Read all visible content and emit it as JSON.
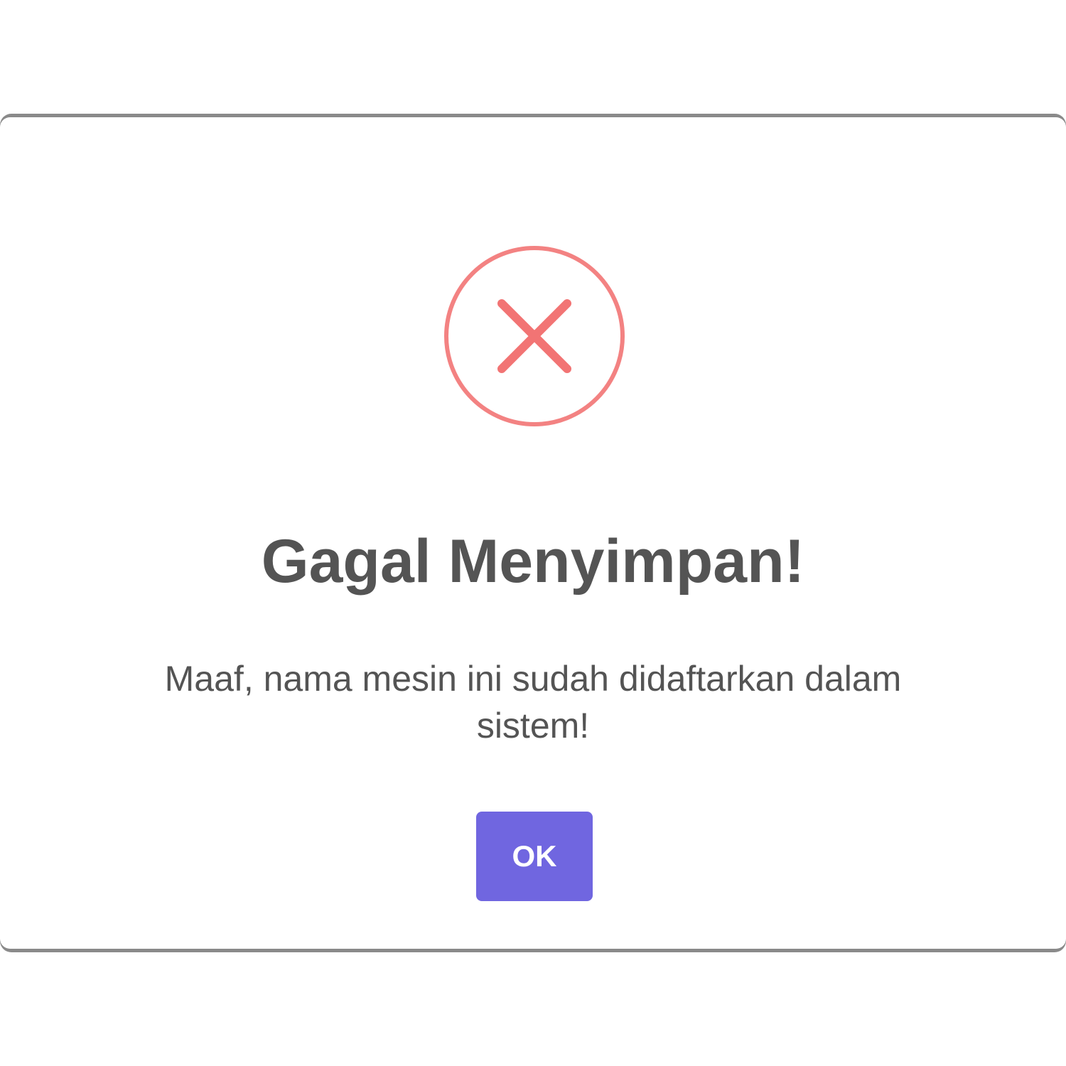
{
  "dialog": {
    "icon": "error-x-circle-icon",
    "icon_color": "#f27474",
    "title": "Gagal Menyimpan!",
    "message": "Maaf, nama mesin ini sudah didaftarkan dalam sistem!",
    "confirm_label": "OK",
    "confirm_color": "#7066e0",
    "text_color": "#545454"
  }
}
